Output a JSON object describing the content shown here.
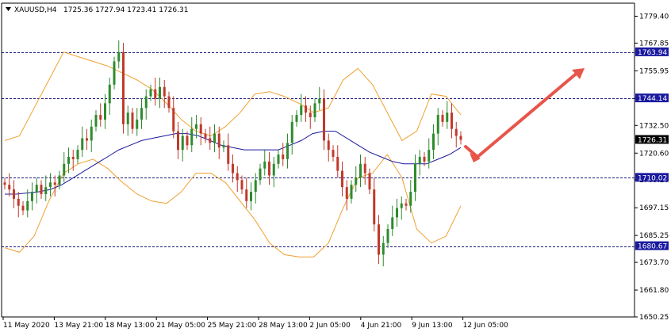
{
  "header": {
    "symbol": "XAUUSD,H4",
    "ohlc": "1725.36 1727.94 1723.41 1726.31"
  },
  "colors": {
    "background": "#ffffff",
    "frame": "#000000",
    "bull_candle": "#2e8b2e",
    "bear_candle": "#c0392b",
    "bollinger": "#f0a030",
    "moving_average": "#1a1aa0",
    "level_line": "#1a1a7a",
    "level_label_bg": "#1a1aa0",
    "price_label_bg": "#000000",
    "arrow": "#e8554a"
  },
  "icons": {
    "collapse": "triangle-down-icon"
  },
  "price_scale": {
    "min": 1650.25,
    "max": 1785.0,
    "ticks": [
      "1779.40",
      "1767.85",
      "1755.95",
      "1744.14",
      "1732.50",
      "1720.60",
      "1709.20",
      "1697.15",
      "1685.25",
      "1673.70",
      "1661.80",
      "1650.25"
    ]
  },
  "levels": [
    {
      "price": 1763.94,
      "label": "1763.94"
    },
    {
      "price": 1744.14,
      "label": "1744.14"
    },
    {
      "price": 1710.02,
      "label": "1710.02"
    },
    {
      "price": 1680.67,
      "label": "1680.67"
    }
  ],
  "current_price": {
    "price": 1726.31,
    "label": "1726.31"
  },
  "time_labels": [
    "11 May 2020",
    "13 May 21:00",
    "18 May 13:00",
    "21 May 05:00",
    "25 May 21:00",
    "28 May 13:00",
    "2 Jun 05:00",
    "4 Jun 21:00",
    "9 Jun 13:00",
    "12 Jun 05:00"
  ],
  "chart_data": {
    "type": "candlestick",
    "symbol": "XAUUSD",
    "timeframe": "H4",
    "series": [
      {
        "name": "price",
        "close": [
          1707,
          1705,
          1701,
          1698,
          1696,
          1700,
          1704,
          1707,
          1703,
          1706,
          1708,
          1707,
          1711,
          1716,
          1719,
          1718,
          1722,
          1727,
          1726,
          1732,
          1737,
          1735,
          1742,
          1750,
          1760,
          1764,
          1733,
          1738,
          1731,
          1735,
          1740,
          1745,
          1748,
          1744,
          1749,
          1745,
          1740,
          1730,
          1722,
          1728,
          1724,
          1731,
          1733,
          1729,
          1727,
          1725,
          1729,
          1723,
          1724,
          1716,
          1712,
          1709,
          1705,
          1700,
          1704,
          1709,
          1714,
          1717,
          1711,
          1716,
          1720,
          1718,
          1725,
          1734,
          1737,
          1741,
          1738,
          1736,
          1742,
          1744,
          1726,
          1722,
          1719,
          1713,
          1706,
          1701,
          1707,
          1710,
          1716,
          1712,
          1705,
          1690,
          1677,
          1682,
          1688,
          1693,
          1697,
          1699,
          1698,
          1704,
          1716,
          1719,
          1717,
          1722,
          1729,
          1737,
          1734,
          1738,
          1731,
          1728,
          1726.31
        ]
      },
      {
        "name": "moving_average",
        "values": [
          1703,
          1703,
          1703.5,
          1704,
          1705,
          1707,
          1710,
          1713,
          1716,
          1719,
          1722,
          1724,
          1726,
          1727,
          1728,
          1729,
          1729,
          1728,
          1726,
          1724,
          1723,
          1722,
          1722,
          1722,
          1722,
          1724,
          1726,
          1729,
          1730,
          1730,
          1727,
          1724,
          1721,
          1719,
          1717,
          1716,
          1716,
          1716,
          1718,
          1720,
          1723
        ]
      },
      {
        "name": "bollinger_upper",
        "values": [
          1726,
          1728,
          1740,
          1752,
          1764,
          1762,
          1760,
          1758,
          1755,
          1752,
          1748,
          1742,
          1735,
          1730,
          1728,
          1732,
          1738,
          1746,
          1747,
          1745,
          1742,
          1738,
          1740,
          1752,
          1757,
          1750,
          1738,
          1726,
          1730,
          1746,
          1745,
          1737
        ]
      },
      {
        "name": "bollinger_lower",
        "values": [
          1680,
          1678,
          1685,
          1700,
          1712,
          1716,
          1718,
          1714,
          1708,
          1703,
          1700,
          1699,
          1704,
          1712,
          1712,
          1708,
          1700,
          1692,
          1682,
          1677,
          1676,
          1676,
          1682,
          1697,
          1710,
          1712,
          1720,
          1710,
          1688,
          1682,
          1685,
          1698
        ]
      }
    ],
    "ylim": [
      1650.25,
      1785.0
    ],
    "grid": false
  }
}
